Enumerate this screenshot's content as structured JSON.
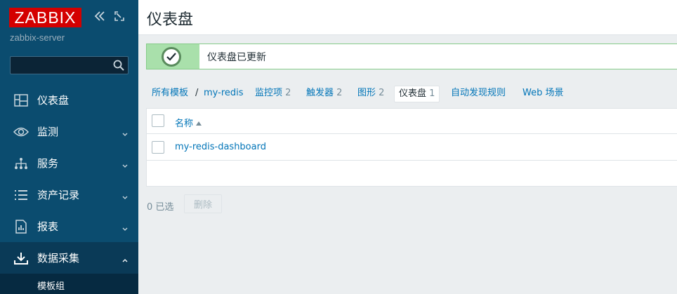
{
  "sidebar": {
    "logo": "ZABBIX",
    "server": "zabbix-server",
    "search": {
      "value": "",
      "placeholder": ""
    },
    "items": [
      {
        "label": "仪表盘",
        "icon": "dashboard-icon"
      },
      {
        "label": "监测",
        "icon": "eye-icon"
      },
      {
        "label": "服务",
        "icon": "services-icon"
      },
      {
        "label": "资产记录",
        "icon": "list-icon"
      },
      {
        "label": "报表",
        "icon": "report-icon"
      },
      {
        "label": "数据采集",
        "icon": "download-icon"
      }
    ],
    "sub_item": "模板组"
  },
  "header": {
    "title": "仪表盘"
  },
  "message": {
    "text": "仪表盘已更新",
    "color": "#86cc89"
  },
  "breadcrumb": {
    "all_templates": "所有模板",
    "separator": "/",
    "template": "my-redis"
  },
  "tabs": [
    {
      "label": "监控项",
      "count": "2"
    },
    {
      "label": "触发器",
      "count": "2"
    },
    {
      "label": "图形",
      "count": "2"
    },
    {
      "label": "仪表盘",
      "count": "1"
    },
    {
      "label": "自动发现规则",
      "count": ""
    },
    {
      "label": "Web 场景",
      "count": ""
    }
  ],
  "table": {
    "column_name": "名称",
    "rows": [
      {
        "name": "my-redis-dashboard"
      }
    ]
  },
  "footer": {
    "selected": "0 已选",
    "delete_button": "删除"
  },
  "colors": {
    "sidebar": "#0b4c6f",
    "brand": "#d40000",
    "link": "#0275b8",
    "success": "#86cc89"
  }
}
